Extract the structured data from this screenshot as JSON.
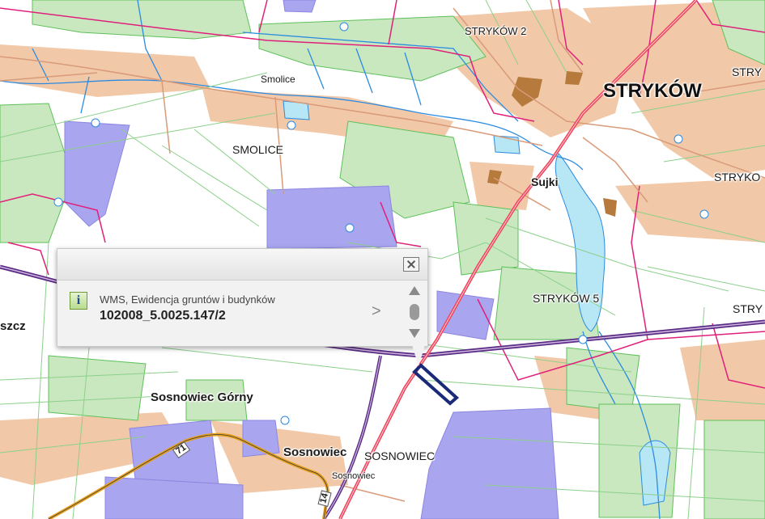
{
  "map": {
    "colors": {
      "background": "#ffffff",
      "forest": "#c9e8c0",
      "forest_edge": "#5ec05a",
      "industrial": "#a9a5ef",
      "built_up": "#f2c9a8",
      "building": "#b57a3c",
      "water": "#b7e6f4",
      "stream": "#2c8be0",
      "boundary": "#e0207a",
      "railway": "#5b2b86",
      "main_road": "#f0435b",
      "secondary_road": "#e6a020",
      "local_road": "#d99a7a",
      "parcel_line": "#8cd08a",
      "highlight_parcel": "#1b2a78"
    },
    "labels": [
      {
        "id": "stryków-2",
        "text": "STRYKÓW 2"
      },
      {
        "id": "smolice-village",
        "text": "Smolice"
      },
      {
        "id": "smolice",
        "text": "SMOLICE"
      },
      {
        "id": "stryków",
        "text": "STRYKÓW"
      },
      {
        "id": "stry-right-top",
        "text": "STRY"
      },
      {
        "id": "stryko-right",
        "text": "STRYKO"
      },
      {
        "id": "sujki",
        "text": "Sujki"
      },
      {
        "id": "stryków-5",
        "text": "STRYKÓW 5"
      },
      {
        "id": "stry-right-mid",
        "text": "STRY"
      },
      {
        "id": "szcz",
        "text": "szcz"
      },
      {
        "id": "sosnowiec-górny",
        "text": "Sosnowiec Górny"
      },
      {
        "id": "sosnowiec-bold",
        "text": "Sosnowiec"
      },
      {
        "id": "sosnowiec-caps",
        "text": "SOSNOWIEC"
      },
      {
        "id": "sosnowiec-small",
        "text": "Sosnowiec"
      },
      {
        "id": "road-71",
        "text": "71"
      },
      {
        "id": "road-14",
        "text": "14"
      }
    ]
  },
  "popup": {
    "close_icon": "close-icon",
    "info_icon": "info-icon",
    "info_glyph": "i",
    "layer_name": "WMS, Ewidencja gruntów i budynków",
    "parcel_id": "102008_5.0025.147/2",
    "next_icon": "chevron-right-icon",
    "next_glyph": ">"
  }
}
